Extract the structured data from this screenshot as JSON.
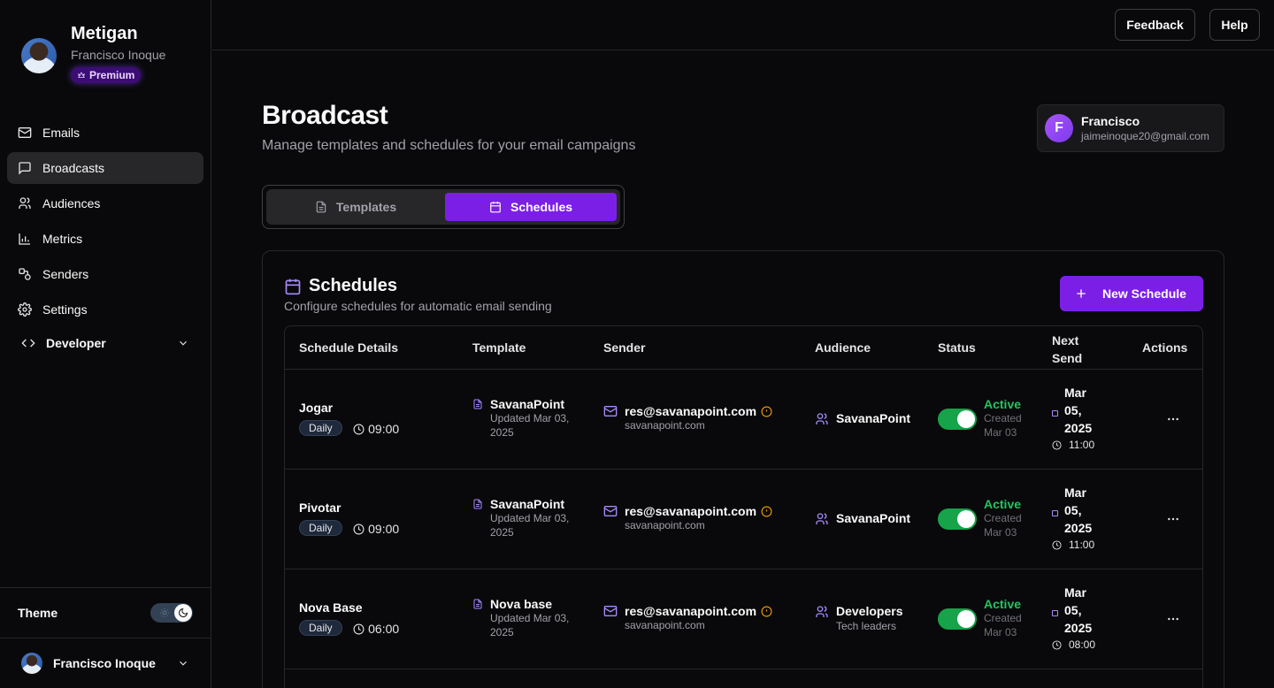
{
  "sidebar": {
    "app_name": "Metigan",
    "user_name": "Francisco Inoque",
    "plan_badge": "Premium",
    "nav": [
      {
        "label": "Emails",
        "icon": "mail-icon"
      },
      {
        "label": "Broadcasts",
        "icon": "message-square-icon"
      },
      {
        "label": "Audiences",
        "icon": "users-icon"
      },
      {
        "label": "Metrics",
        "icon": "bar-chart-icon"
      },
      {
        "label": "Senders",
        "icon": "senders-icon"
      },
      {
        "label": "Settings",
        "icon": "gear-icon"
      }
    ],
    "developer_label": "Developer",
    "theme_label": "Theme",
    "footer_user": "Francisco Inoque"
  },
  "topbar": {
    "feedback_label": "Feedback",
    "help_label": "Help"
  },
  "page": {
    "title": "Broadcast",
    "subtitle": "Manage templates and schedules for your email campaigns"
  },
  "user_card": {
    "initial": "F",
    "name": "Francisco",
    "email": "jaimeinoque20@gmail.com"
  },
  "tabs": {
    "templates": "Templates",
    "schedules": "Schedules",
    "active": "schedules"
  },
  "schedules_card": {
    "title": "Schedules",
    "subtitle": "Configure schedules for automatic email sending",
    "new_button": "New Schedule"
  },
  "table": {
    "headers": {
      "details": "Schedule Details",
      "template": "Template",
      "sender": "Sender",
      "audience": "Audience",
      "status": "Status",
      "next_send_1": "Next",
      "next_send_2": "Send",
      "actions": "Actions"
    },
    "rows": [
      {
        "name": "Jogar",
        "frequency": "Daily",
        "time": "09:00",
        "template": "SavanaPoint",
        "template_updated": "Updated Mar 03, 2025",
        "sender_email": "res@savanapoint.com",
        "sender_domain": "savanapoint.com",
        "audience": "SavanaPoint",
        "audience_sub": "",
        "status": "Active",
        "status_sub": "Created Mar 03",
        "enabled": true,
        "next_month": "Mar",
        "next_day": "05,",
        "next_year": "2025",
        "next_time": "11:00"
      },
      {
        "name": "Pivotar",
        "frequency": "Daily",
        "time": "09:00",
        "template": "SavanaPoint",
        "template_updated": "Updated Mar 03, 2025",
        "sender_email": "res@savanapoint.com",
        "sender_domain": "savanapoint.com",
        "audience": "SavanaPoint",
        "audience_sub": "",
        "status": "Active",
        "status_sub": "Created Mar 03",
        "enabled": true,
        "next_month": "Mar",
        "next_day": "05,",
        "next_year": "2025",
        "next_time": "11:00"
      },
      {
        "name": "Nova Base",
        "frequency": "Daily",
        "time": "06:00",
        "template": "Nova base",
        "template_updated": "Updated Mar 03, 2025",
        "sender_email": "res@savanapoint.com",
        "sender_domain": "savanapoint.com",
        "audience": "Developers",
        "audience_sub": "Tech leaders",
        "status": "Active",
        "status_sub": "Created Mar 03",
        "enabled": true,
        "next_month": "Mar",
        "next_day": "05,",
        "next_year": "2025",
        "next_time": "08:00"
      }
    ]
  },
  "colors": {
    "accent": "#7c1fe6",
    "active_green": "#22c55e",
    "icon_purple": "#a78bfa",
    "warning": "#f59e0b"
  }
}
